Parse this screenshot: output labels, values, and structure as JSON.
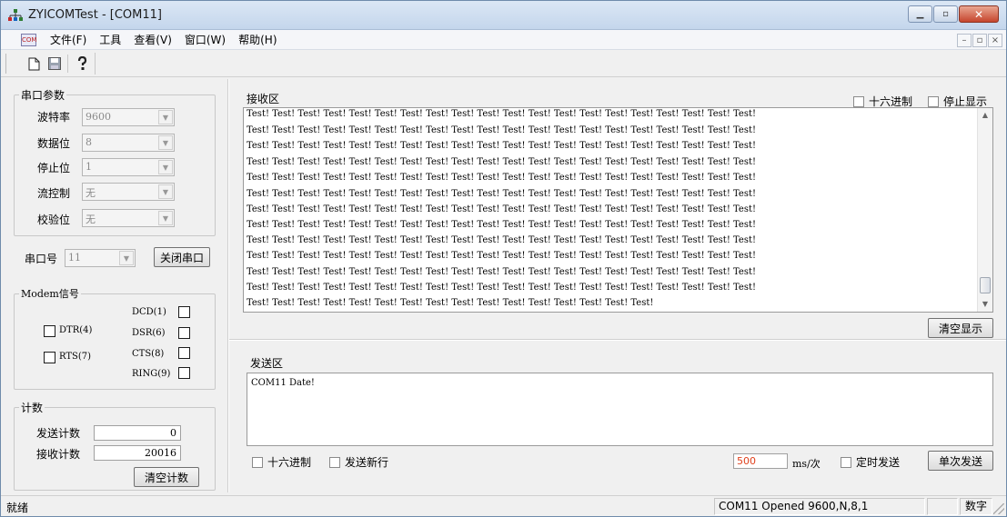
{
  "window": {
    "title": "ZYICOMTest - [COM11]",
    "icons": {
      "app": "network-icon",
      "minimize": "minimize-icon",
      "restore": "restore-icon",
      "close": "close-icon"
    }
  },
  "menu": {
    "items": [
      "文件(F)",
      "工具",
      "查看(V)",
      "窗口(W)",
      "帮助(H)"
    ],
    "com_icon_text": "COM"
  },
  "toolbar": {
    "icons": [
      "new-document-icon",
      "save-icon",
      "help-icon"
    ]
  },
  "serial_params": {
    "group_label": "串口参数",
    "fields": [
      {
        "label": "波特率",
        "value": "9600"
      },
      {
        "label": "数据位",
        "value": "8"
      },
      {
        "label": "停止位",
        "value": "1"
      },
      {
        "label": "流控制",
        "value": "无"
      },
      {
        "label": "校验位",
        "value": "无"
      }
    ],
    "port_label": "串口号",
    "port_value": "11",
    "close_port_button": "关闭串口"
  },
  "modem": {
    "group_label": "Modem信号",
    "signals": [
      "DCD(1)",
      "DTR(4)",
      "DSR(6)",
      "RTS(7)",
      "CTS(8)",
      "RING(9)"
    ]
  },
  "counter": {
    "group_label": "计数",
    "send_label": "发送计数",
    "send_value": "0",
    "recv_label": "接收计数",
    "recv_value": "20016",
    "clear_button": "清空计数"
  },
  "receive": {
    "label": "接收区",
    "hex_option": "十六进制",
    "stop_option": "停止显示",
    "full_line": "Test! Test! Test! Test! Test! Test! Test! Test! Test! Test! Test! Test! Test! Test! Test! Test! Test! Test! Test! Test!",
    "last_line": "Test! Test! Test! Test! Test! Test! Test! Test! Test! Test! Test! Test! Test! Test! Test! Test!",
    "clear_button": "清空显示"
  },
  "send": {
    "label": "发送区",
    "content": "COM11 Date!",
    "hex_option": "十六进制",
    "newline_option": "发送新行",
    "interval_value": "500",
    "interval_unit": "ms/次",
    "timed_option": "定时发送",
    "send_button": "单次发送"
  },
  "status": {
    "ready": "就绪",
    "port_status": "COM11  Opened   9600,N,8,1",
    "num_lock": "数字"
  }
}
